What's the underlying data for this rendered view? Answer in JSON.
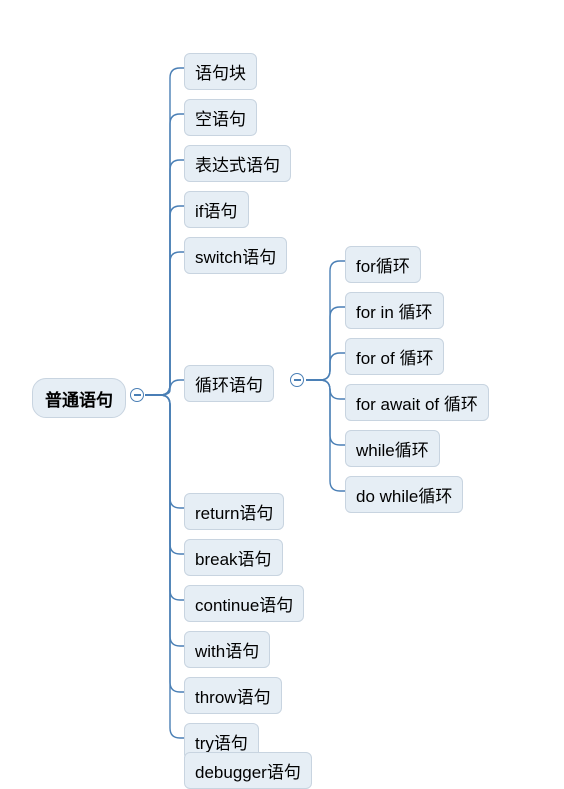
{
  "root": {
    "label": "普通语句"
  },
  "children": [
    {
      "label": "语句块"
    },
    {
      "label": "空语句"
    },
    {
      "label": "表达式语句"
    },
    {
      "label": "if语句"
    },
    {
      "label": "switch语句"
    },
    {
      "label": "循环语句",
      "children": [
        {
          "label": "for循环"
        },
        {
          "label": "for in 循环"
        },
        {
          "label": "for of 循环"
        },
        {
          "label": "for await of 循环"
        },
        {
          "label": "while循环"
        },
        {
          "label": "do while循环"
        }
      ]
    },
    {
      "label": "return语句"
    },
    {
      "label": "break语句"
    },
    {
      "label": "continue语句"
    },
    {
      "label": "with语句"
    },
    {
      "label": "throw语句"
    },
    {
      "label": "try语句"
    },
    {
      "label": "debugger语句"
    }
  ]
}
